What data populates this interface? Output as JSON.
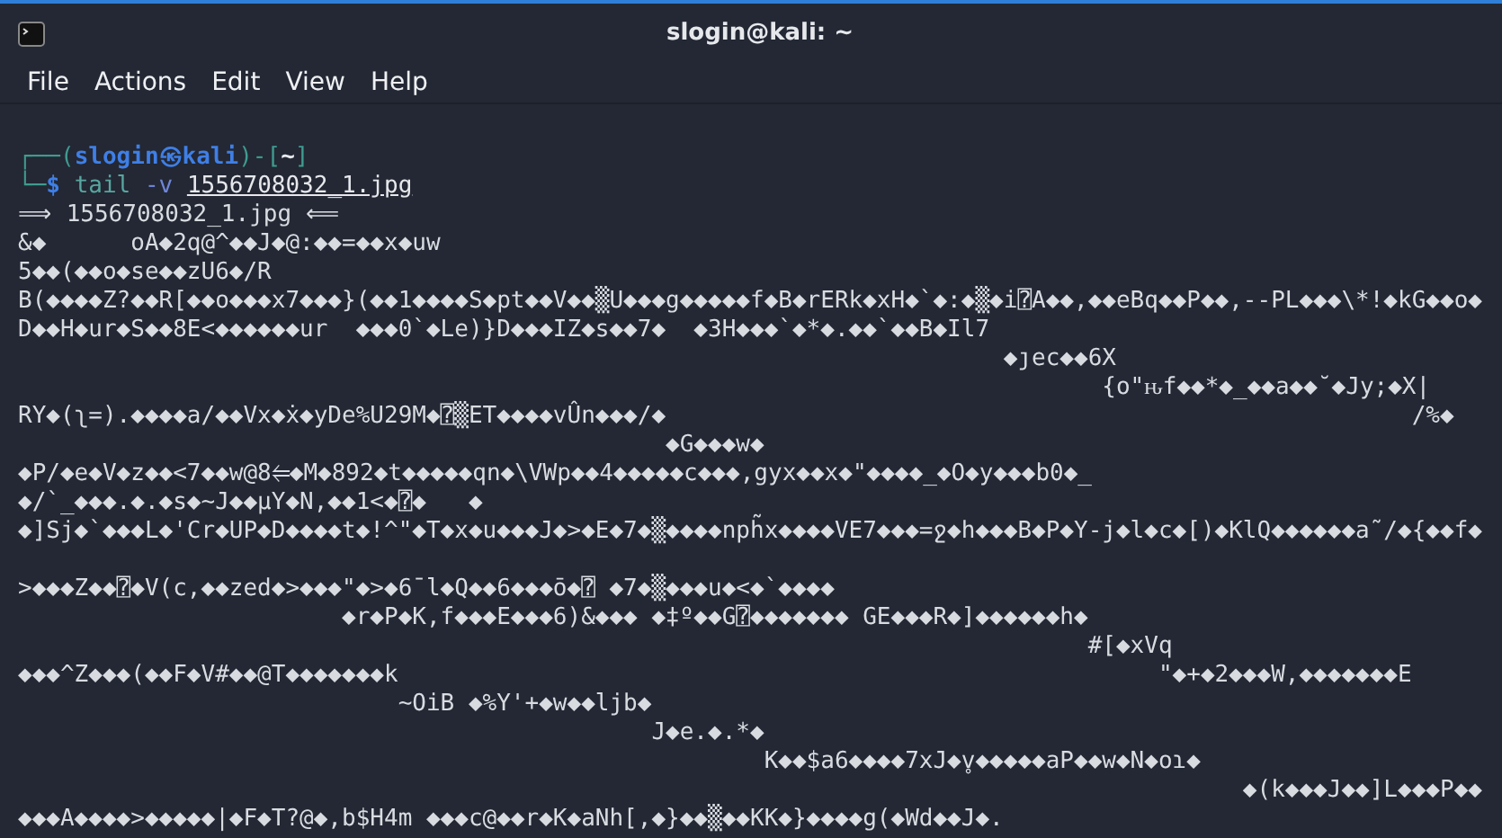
{
  "window": {
    "title": "slogin@kali: ~"
  },
  "menu": [
    "File",
    "Actions",
    "Edit",
    "View",
    "Help"
  ],
  "prompt": {
    "frame_open": "┌──(",
    "user_host": "slogin㉿kali",
    "frame_mid": ")-[",
    "dir": "~",
    "frame_close": "]"
  },
  "command": {
    "frame": "└─",
    "symbol": "$",
    "name": "tail",
    "option": "-v",
    "argument": "1556708032_1.jpg"
  },
  "output": [
    "⟹ 1556708032_1.jpg ⟸",
    "&◆      oA◆2q@^◆◆J◆@:◆◆=◆◆x◆uw",
    "5◆◆(◆◆o◆se◆◆zU6◆/R",
    "B(◆◆◆◆Z?◆◆R[◆◆o◆◆◆x7◆◆◆}(◆◆1◆◆◆◆S◆pt◆◆V◆◆▒U◆◆◆g◆◆◆◆◆f◆B◆rERk◆xH◆`◆:◆▒◆i⍰A◆◆,◆◆eBq◆◆P◆◆,--PL◆◆◆\\*!◆kG◆◆o◆",
    "D◆◆H◆ur◆S◆◆8E<◆◆◆◆◆◆ur  ◆◆◆0`◆Le)}D◆◆◆IZ◆s◆◆7◆  ◆3H◆◆◆`◆*◆.◆◆`◆◆B◆Il7",
    "                                                                      ◆ȷec◆◆6X",
    "                                                                             {o\"ԋf◆◆*◆_◆◆a◆◆˘◆Jy;◆X|",
    "RY◆(ʅ=).◆◆◆◆a/◆◆Vx◆ẋ◆yDe%U29M◆⍰▒ET◆◆◆◆vÛn◆◆◆/◆                                                     /%◆",
    "                                              ◆G◆◆◆w◆",
    "◆P/◆e◆V◆z◆◆<7◆◆w@8⥢◆M◆892◆t◆◆◆◆◆qn◆\\VWp◆◆4◆◆◆◆◆c◆◆◆,gyx◆◆x◆\"◆◆◆◆_◆O◆y◆◆◆b0◆_",
    "◆/`_◆◆◆.◆.◆s◆~J◆◆µY◆N,◆◆1<◆⍰◆   ◆",
    "◆]Sj◆`◆◆◆L◆'Cr◆UP◆D◆◆◆◆t◆!^\"◆T◆x◆u◆◆◆J◆>◆E◆7◆▒◆◆◆◆nph̃x◆◆◆◆VE7◆◆◆=ջ◆h◆◆◆B◆P◆Y-j◆l◆c◆[)◆KlQ◆◆◆◆◆◆a˜/◆{◆◆f◆",
    {
      "kind": "blank"
    },
    ">◆◆◆Z◆◆⍰◆V(c,◆◆zed◆>◆◆◆\"◆>◆6¯l◆Q◆◆6◆◆◆ō◆⍰ ◆7◆▒◆◆◆u◆<◆`◆◆◆◆",
    "                       ◆r◆P◆K,f◆◆◆E◆◆◆6)&◆◆◆ ◆‡º◆◆G⍰◆◆◆◆◆◆◆ GE◆◆◆R◆]◆◆◆◆◆◆h◆",
    "                                                                            #[◆xVq",
    "◆◆◆^Z◆◆◆(◆◆F◆V#◆◆@T◆◆◆◆◆◆◆k                                                      \"◆+◆2◆◆◆W,◆◆◆◆◆◆◆E",
    "                           ~OiB ◆%Y'+◆w◆◆ljb◆",
    "                                             J◆e.◆.*◆",
    "                                                     K◆◆$a6◆◆◆◆7xJ◆v̥◆◆◆◆◆aP◆◆w◆N◆oɿ◆",
    "                                                                                       ◆(k◆◆◆J◆◆]L◆◆◆P◆◆",
    "◆◆◆A◆◆◆◆>◆◆◆◆◆|◆F◆T?@◆,b$H4m ◆◆◆c@◆◆r◆K◆aNh[,◆}◆◆▒◆◆KK◆}◆◆◆◆g(◆Wd◆◆J◆."
  ]
}
